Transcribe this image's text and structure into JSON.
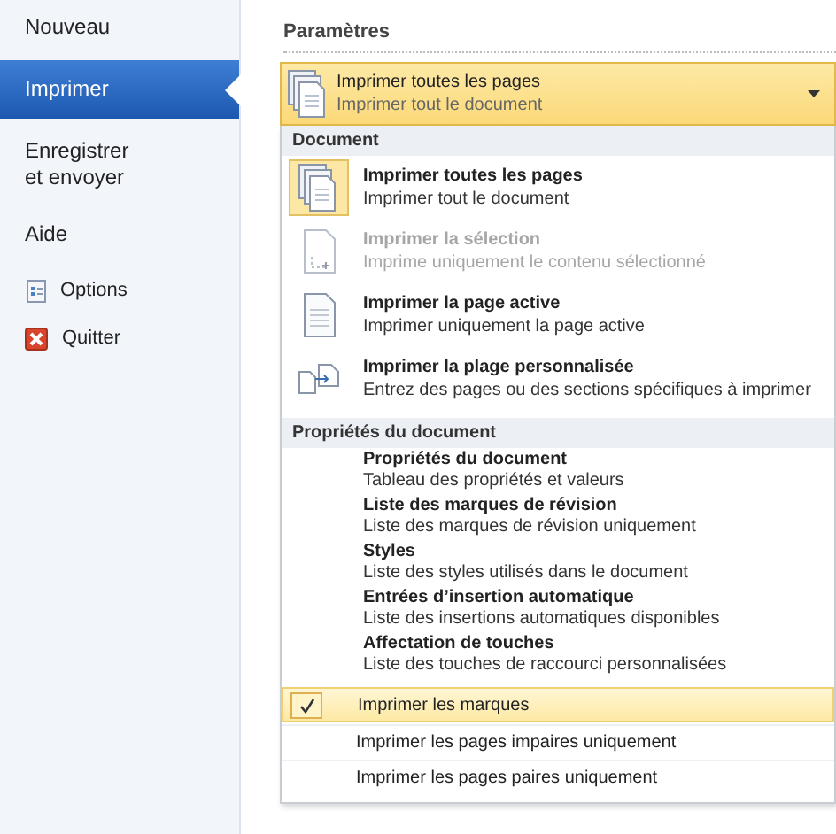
{
  "sidebar": {
    "items": [
      {
        "label": "Nouveau",
        "kind": "plain",
        "selected": false
      },
      {
        "label": "Imprimer",
        "kind": "plain",
        "selected": true
      },
      {
        "label": "Enregistrer\net envoyer",
        "kind": "plain",
        "selected": false
      },
      {
        "label": "Aide",
        "kind": "plain",
        "selected": false
      },
      {
        "label": "Options",
        "kind": "options",
        "selected": false
      },
      {
        "label": "Quitter",
        "kind": "exit",
        "selected": false
      }
    ]
  },
  "settings": {
    "heading": "Paramètres",
    "dropdown": {
      "title": "Imprimer toutes les pages",
      "description": "Imprimer tout le document"
    },
    "menu": [
      {
        "heading": "Document",
        "kind": "icons",
        "items": [
          {
            "title": "Imprimer toutes les pages",
            "description": "Imprimer tout le document",
            "kind": "all",
            "selected": true,
            "disabled": false
          },
          {
            "title": "Imprimer la sélection",
            "description": "Imprime uniquement le contenu sélectionné",
            "kind": "selection",
            "selected": false,
            "disabled": true
          },
          {
            "title": "Imprimer la page active",
            "description": "Imprimer uniquement la page active",
            "kind": "page",
            "selected": false,
            "disabled": false
          },
          {
            "title": "Imprimer la plage personnalisée",
            "description": "Entrez des pages ou des sections spécifiques à imprimer",
            "kind": "range",
            "selected": false,
            "disabled": false
          }
        ]
      },
      {
        "heading": "Propriétés du document",
        "kind": "text",
        "items": [
          {
            "title": "Propriétés du document",
            "description": "Tableau des propriétés et valeurs"
          },
          {
            "title": "Liste des marques de révision",
            "description": "Liste des marques de révision uniquement"
          },
          {
            "title": "Styles",
            "description": "Liste des styles utilisés dans le document"
          },
          {
            "title": "Entrées d’insertion automatique",
            "description": "Liste des insertions automatiques disponibles"
          },
          {
            "title": "Affectation de touches",
            "description": "Liste des touches de raccourci personnalisées"
          }
        ]
      },
      {
        "kind": "checks",
        "items": [
          {
            "label": "Imprimer les marques",
            "checked": true
          },
          {
            "label": "Imprimer les pages impaires uniquement",
            "checked": false
          },
          {
            "label": "Imprimer les pages paires uniquement",
            "checked": false
          }
        ]
      }
    ]
  }
}
